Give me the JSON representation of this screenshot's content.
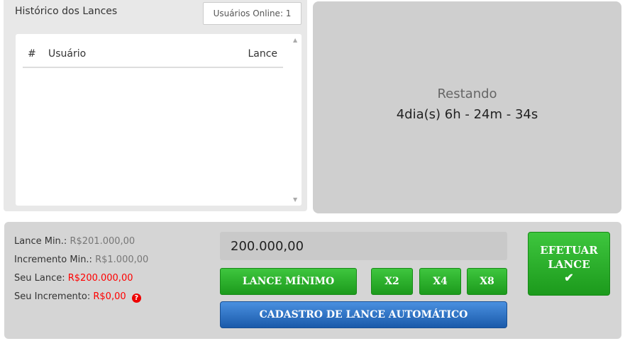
{
  "history": {
    "title": "Histórico dos Lances",
    "online_label": "Usuários Online: 1",
    "columns": [
      "#",
      "Usuário",
      "Lance"
    ],
    "rows": []
  },
  "countdown": {
    "label": "Restando",
    "value": "4dia(s) 6h - 24m - 34s"
  },
  "bid_info": {
    "lance_min_label": "Lance Min.:",
    "lance_min_value": "R$201.000,00",
    "incremento_min_label": "Incremento Min.:",
    "incremento_min_value": "R$1.000,00",
    "seu_lance_label": "Seu Lance:",
    "seu_lance_value": "R$200.000,00",
    "seu_incremento_label": "Seu Incremento:",
    "seu_incremento_value": "R$0,00"
  },
  "bid_form": {
    "amount_value": "200.000,00",
    "lance_minimo_label": "LANCE MÍNIMO",
    "x2_label": "X2",
    "x4_label": "X4",
    "x8_label": "X8",
    "auto_bid_label": "CADASTRO DE LANCE AUTOMÁTICO",
    "submit_line1": "EFETUAR",
    "submit_line2": "LANCE"
  },
  "icons": {
    "help": "question-circle-icon",
    "check": "check-icon"
  },
  "colors": {
    "green": "#1c9a1c",
    "blue": "#1a5aaa",
    "red": "#ff0000"
  }
}
